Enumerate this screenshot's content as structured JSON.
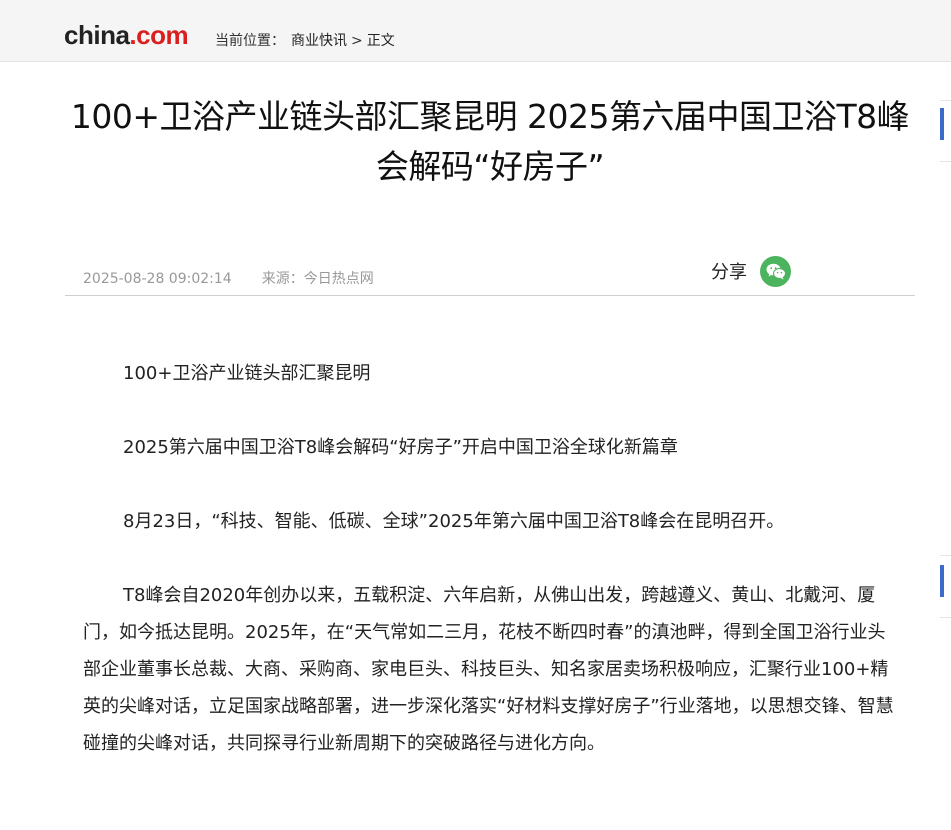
{
  "header": {
    "logo": {
      "china": "china",
      "dot": ".",
      "com": "com"
    },
    "breadcrumb": {
      "label": "当前位置：",
      "items": [
        "商业快讯",
        "正文"
      ],
      "separator": ">"
    }
  },
  "article": {
    "title": "100+卫浴产业链头部汇聚昆明 2025第六届中国卫浴T8峰会解码“好房子”",
    "datetime": "2025-08-28 09:02:14",
    "source": "来源：今日热点网",
    "share_label": "分享",
    "paragraphs": [
      "100+卫浴产业链头部汇聚昆明",
      "2025第六届中国卫浴T8峰会解码“好房子”开启中国卫浴全球化新篇章",
      "8月23日，“科技、智能、低碳、全球”2025年第六届中国卫浴T8峰会在昆明召开。",
      "T8峰会自2020年创办以来，五载积淀、六年启新，从佛山出发，跨越遵义、黄山、北戴河、厦门，如今抵达昆明。2025年，在“天气常如二三月，花枝不断四时春”的滇池畔，得到全国卫浴行业头部企业董事长总裁、大商、采购商、家电巨头、科技巨头、知名家居卖场积极响应，汇聚行业100+精英的尖峰对话，立足国家战略部署，进一步深化落实“好材料支撑好房子”行业落地，以思想交锋、智慧碰撞的尖峰对话，共同探寻行业新周期下的突破路径与进化方向。"
    ]
  },
  "colors": {
    "logo_red": "#d9201e",
    "wechat_green": "#4cb35f",
    "accent_blue": "#3b6bc8"
  },
  "icons": {
    "share": "wechat-icon"
  }
}
